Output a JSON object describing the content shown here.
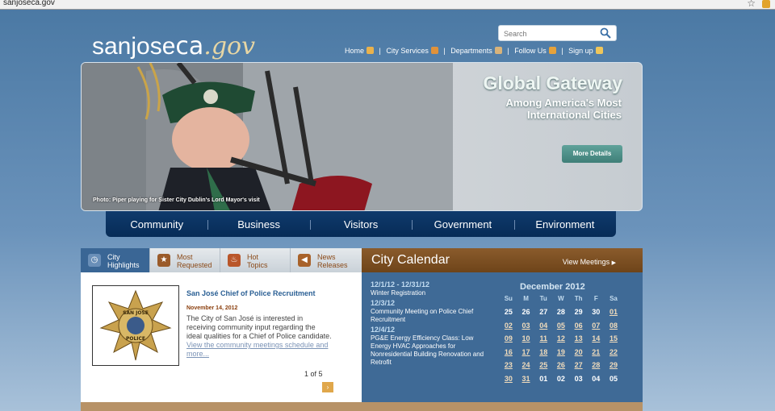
{
  "browser": {
    "url": "sanjoseca.gov"
  },
  "header": {
    "logo": {
      "part1": "sanjose",
      "part2": "ca",
      "part3": ".gov"
    },
    "search": {
      "placeholder": "Search"
    },
    "toplinks": {
      "home": "Home",
      "city_services": "City Services",
      "departments": "Departments",
      "follow_us": "Follow Us",
      "sign_up": "Sign up",
      "separator": "|"
    }
  },
  "hero": {
    "title": "Global Gateway",
    "subtitle": "Among America's Most\nInternational Cities",
    "button": "More Details",
    "caption": "Photo: Piper playing for Sister City Dublin's Lord Mayor's visit"
  },
  "nav": {
    "items": [
      "Community",
      "Business",
      "Visitors",
      "Government",
      "Environment"
    ]
  },
  "tabs": [
    {
      "line1": "City",
      "line2": "Highlights",
      "icon": "clock-icon",
      "color": "#6a8fb8"
    },
    {
      "line1": "Most",
      "line2": "Requested",
      "icon": "star-icon",
      "color": "#9a5b2a"
    },
    {
      "line1": "Hot",
      "line2": "Topics",
      "icon": "flame-icon",
      "color": "#b9562a"
    },
    {
      "line1": "News",
      "line2": "Releases",
      "icon": "megaphone-icon",
      "color": "#a8622a"
    }
  ],
  "feature": {
    "title": "San José Chief of Police Recruitment",
    "date": "November 14, 2012",
    "body": "The City of San José is interested in receiving community input regarding the ideal qualities for a Chief of Police candidate.",
    "link": "View the community meetings schedule and more...",
    "badge_text": {
      "top": "SAN JOSE",
      "bottom": "POLICE"
    },
    "pager": "1 of 5",
    "next": "›"
  },
  "calendar": {
    "title": "City Calendar",
    "view_meetings": "View Meetings",
    "arrow": "▶",
    "events": [
      {
        "date": "12/1/12 - 12/31/12",
        "text": "Winter Registration"
      },
      {
        "date": "12/3/12",
        "text": "Community Meeting on Police Chief Recruitment"
      },
      {
        "date": "12/4/12",
        "text": "PG&E Energy Efficiency Class: Low Energy HVAC Approaches for Nonresidential Building Renovation and Retrofit"
      }
    ],
    "month": "December 2012",
    "dow": [
      "Su",
      "M",
      "Tu",
      "W",
      "Th",
      "F",
      "Sa"
    ],
    "days": [
      {
        "d": "25",
        "link": false
      },
      {
        "d": "26",
        "link": false
      },
      {
        "d": "27",
        "link": false
      },
      {
        "d": "28",
        "link": false
      },
      {
        "d": "29",
        "link": false
      },
      {
        "d": "30",
        "link": false
      },
      {
        "d": "01",
        "link": true
      },
      {
        "d": "02",
        "link": true
      },
      {
        "d": "03",
        "link": true
      },
      {
        "d": "04",
        "link": true
      },
      {
        "d": "05",
        "link": true
      },
      {
        "d": "06",
        "link": true
      },
      {
        "d": "07",
        "link": true
      },
      {
        "d": "08",
        "link": true
      },
      {
        "d": "09",
        "link": true
      },
      {
        "d": "10",
        "link": true
      },
      {
        "d": "11",
        "link": true
      },
      {
        "d": "12",
        "link": true
      },
      {
        "d": "13",
        "link": true
      },
      {
        "d": "14",
        "link": true
      },
      {
        "d": "15",
        "link": true
      },
      {
        "d": "16",
        "link": true
      },
      {
        "d": "17",
        "link": true
      },
      {
        "d": "18",
        "link": true
      },
      {
        "d": "19",
        "link": true
      },
      {
        "d": "20",
        "link": true
      },
      {
        "d": "21",
        "link": true
      },
      {
        "d": "22",
        "link": true
      },
      {
        "d": "23",
        "link": true
      },
      {
        "d": "24",
        "link": true
      },
      {
        "d": "25",
        "link": true
      },
      {
        "d": "26",
        "link": true
      },
      {
        "d": "27",
        "link": true
      },
      {
        "d": "28",
        "link": true
      },
      {
        "d": "29",
        "link": true
      },
      {
        "d": "30",
        "link": true
      },
      {
        "d": "31",
        "link": true
      },
      {
        "d": "01",
        "link": false
      },
      {
        "d": "02",
        "link": false
      },
      {
        "d": "03",
        "link": false
      },
      {
        "d": "04",
        "link": false
      },
      {
        "d": "05",
        "link": false
      }
    ]
  }
}
